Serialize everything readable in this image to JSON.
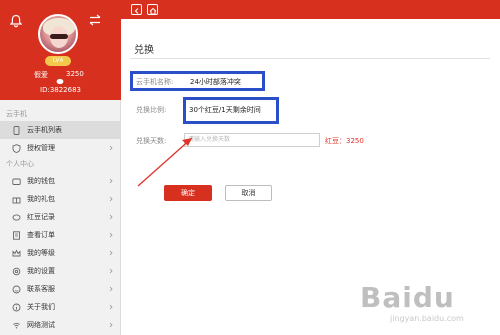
{
  "profile": {
    "name": "假爱",
    "bean_count": "3250",
    "id_text": "ID:3822683",
    "level": "LV4"
  },
  "sidebar": {
    "section_cloud": "云手机",
    "section_personal": "个人中心",
    "items": [
      {
        "label": "云手机列表",
        "icon": "phone-icon"
      },
      {
        "label": "授权管理",
        "icon": "shield-icon"
      },
      {
        "label": "我的钱包",
        "icon": "wallet-icon"
      },
      {
        "label": "我的礼包",
        "icon": "gift-icon"
      },
      {
        "label": "红豆记录",
        "icon": "bean-icon"
      },
      {
        "label": "查看订单",
        "icon": "order-icon"
      },
      {
        "label": "我的等级",
        "icon": "crown-icon"
      },
      {
        "label": "我的设置",
        "icon": "gear-icon"
      },
      {
        "label": "联系客服",
        "icon": "support-icon"
      },
      {
        "label": "关于我们",
        "icon": "info-icon"
      },
      {
        "label": "网络测试",
        "icon": "network-icon"
      }
    ]
  },
  "topbar": {
    "back_icon": "chevron-left-icon",
    "home_icon": "home-icon"
  },
  "main": {
    "title": "兑换",
    "phone_name_label": "云手机名称:",
    "phone_name_value": "24小时部落冲突",
    "ratio_label": "兑换比例:",
    "ratio_value": "30个红豆/1天剩余时间",
    "days_label": "兑换天数:",
    "days_placeholder": "请输入兑换天数",
    "bean_label": "红豆：3250",
    "confirm_label": "确定",
    "cancel_label": "取消"
  },
  "watermark": {
    "text": "Baidu",
    "sub": "jingyan.baidu.com"
  },
  "colors": {
    "brand_red": "#d7301e",
    "highlight_blue": "#2a4fc9",
    "bean_red": "#e0332b"
  }
}
